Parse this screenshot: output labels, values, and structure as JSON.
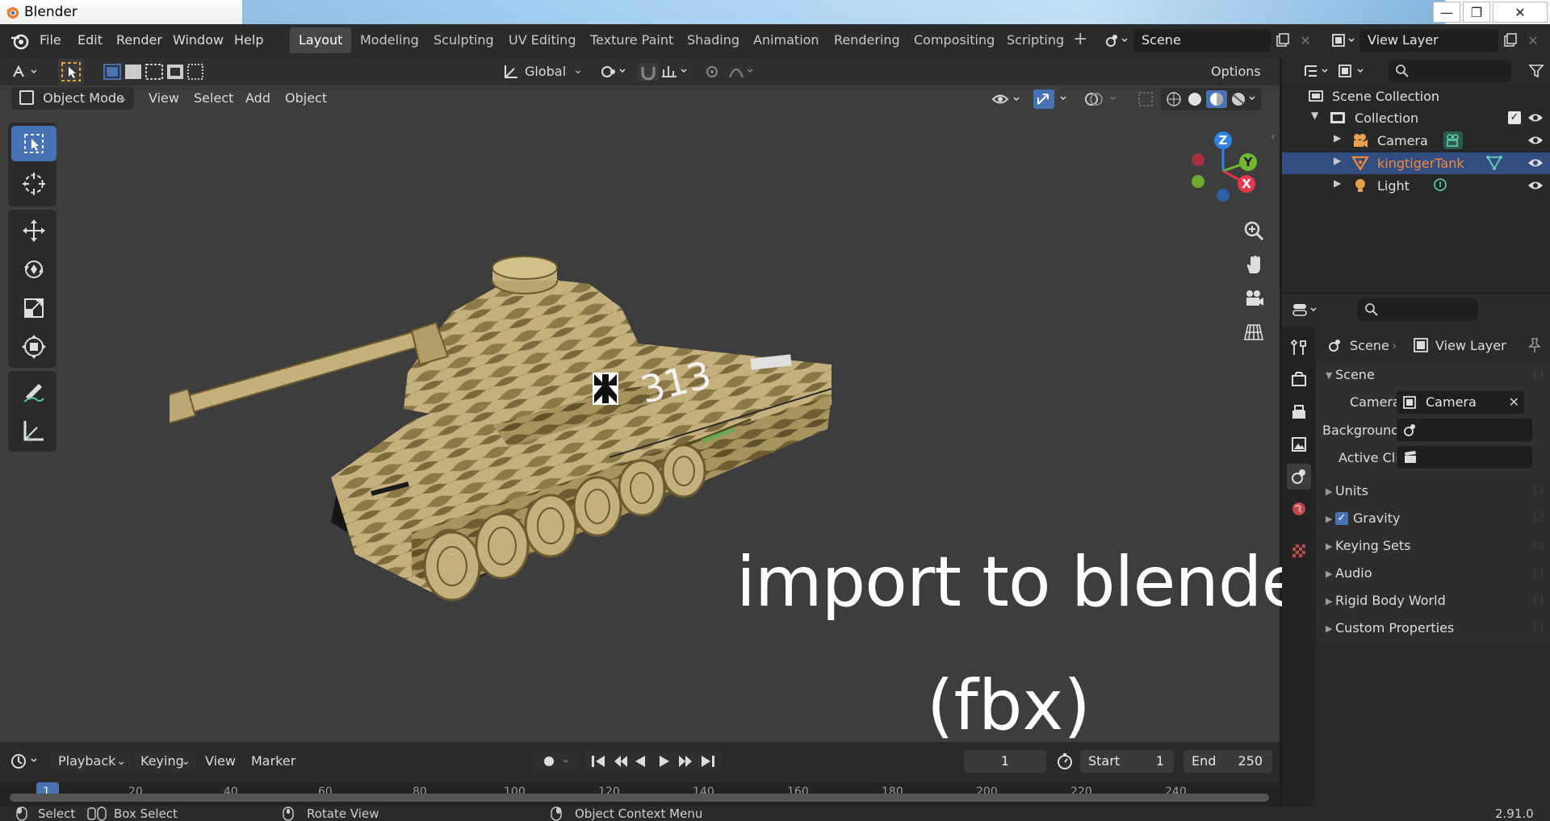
{
  "window": {
    "title": "Blender",
    "minimize": "—",
    "maximize": "❐",
    "close": "✕"
  },
  "menu": [
    "File",
    "Edit",
    "Render",
    "Window",
    "Help"
  ],
  "workspaces": [
    "Layout",
    "Modeling",
    "Sculpting",
    "UV Editing",
    "Texture Paint",
    "Shading",
    "Animation",
    "Rendering",
    "Compositing",
    "Scripting"
  ],
  "workspace_active": "Layout",
  "scene_field": "Scene",
  "view_layer_field": "View Layer",
  "viewport": {
    "orientation": "Global",
    "options_label": "Options",
    "mode": "Object Mode",
    "header_menus": [
      "View",
      "Select",
      "Add",
      "Object"
    ],
    "gizmo_axes": {
      "z": "Z",
      "y": "Y",
      "x": "X"
    },
    "overlay_line1": "import to blender",
    "overlay_line2": "(fbx)",
    "decal_number": "313"
  },
  "timeline": {
    "menus": [
      "Playback",
      "Keying",
      "View",
      "Marker"
    ],
    "current_frame": "1",
    "start_label": "Start",
    "start_value": "1",
    "end_label": "End",
    "end_value": "250",
    "ticks": [
      "1",
      "20",
      "40",
      "60",
      "80",
      "100",
      "120",
      "140",
      "160",
      "180",
      "200",
      "220",
      "240"
    ]
  },
  "outliner": {
    "root": "Scene Collection",
    "collection": "Collection",
    "items": [
      {
        "label": "Camera",
        "color": "#e0e0e0"
      },
      {
        "label": "kingtigerTank",
        "color": "#f28a3b"
      },
      {
        "label": "Light",
        "color": "#e0e0e0"
      }
    ]
  },
  "properties": {
    "breadcrumb_scene": "Scene",
    "breadcrumb_layer": "View Layer",
    "section": "Scene",
    "camera_label": "Camera",
    "camera_value": "Camera",
    "background_label": "Background ...",
    "active_clip_label": "Active Clip",
    "panels": [
      "Units",
      "Gravity",
      "Keying Sets",
      "Audio",
      "Rigid Body World",
      "Custom Properties"
    ]
  },
  "status": {
    "select": "Select",
    "box_select": "Box Select",
    "rotate": "Rotate View",
    "context": "Object Context Menu",
    "version": "2.91.0"
  },
  "colors": {
    "accent": "#4772b3",
    "selected_row": "#334d80",
    "active_object": "#f28a3b",
    "viewport_bg": "#3d3d3d"
  }
}
